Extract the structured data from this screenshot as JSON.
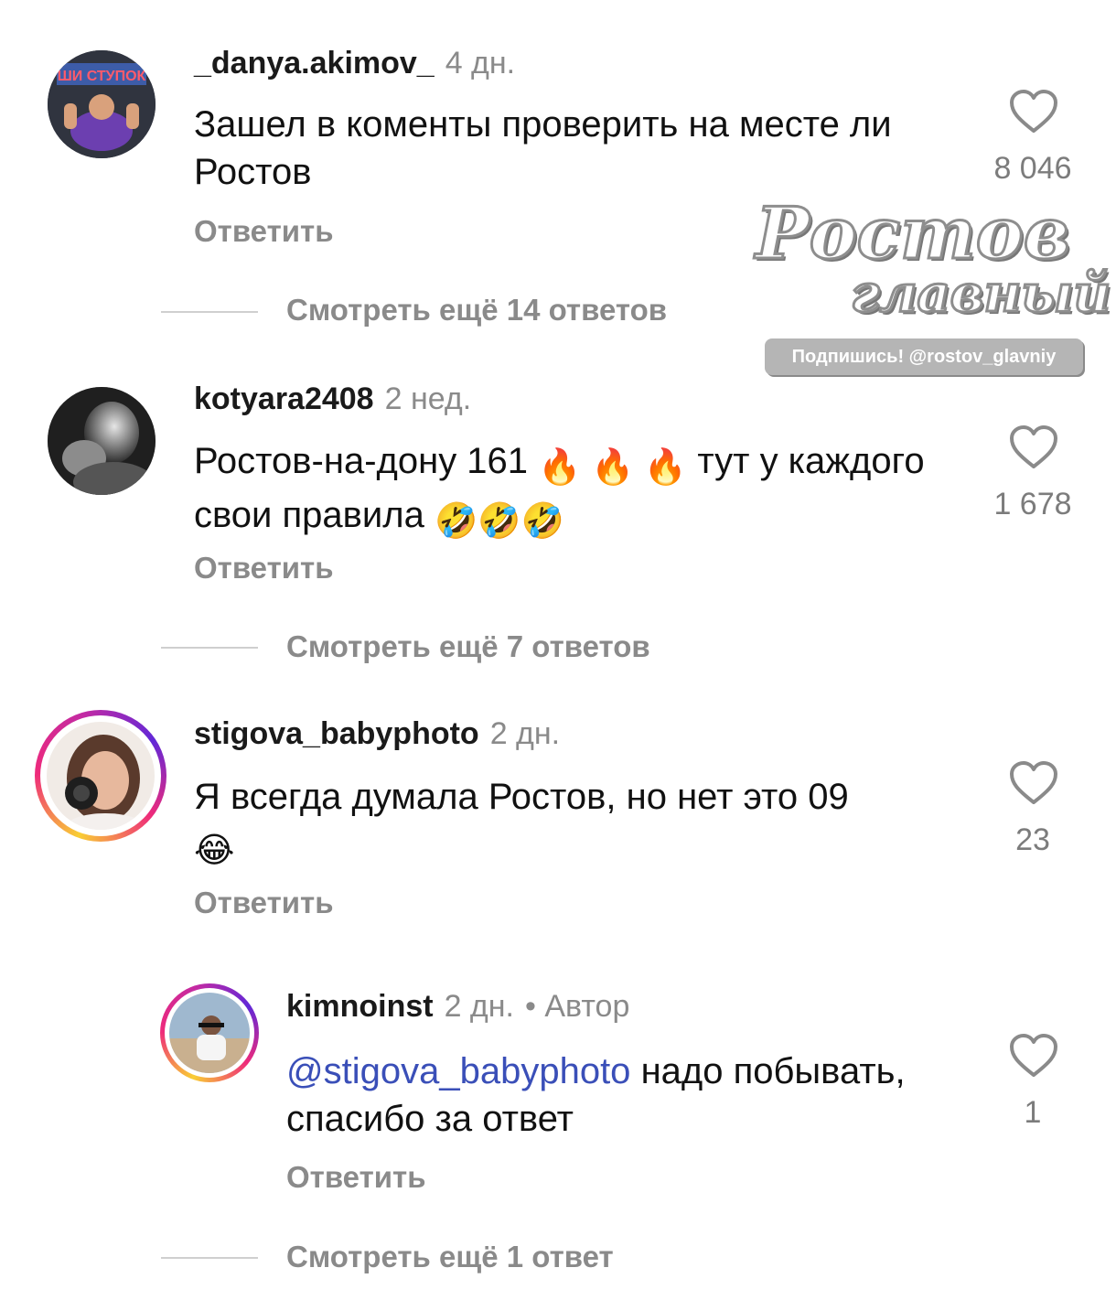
{
  "comments": [
    {
      "username": "_danya.akimov_",
      "time": "4 дн.",
      "text": "Зашел в коменты проверить на месте ли Ростов",
      "reply_label": "Ответить",
      "likes": "8 046",
      "view_more": "Смотреть ещё 14 ответов",
      "avatar_text": "ШИ СТУПОК"
    },
    {
      "username": "kotyara2408",
      "time": "2 нед.",
      "text_prefix": "Ростов-на-дону  161",
      "fire_emojis": "🔥 🔥 🔥",
      "text_middle": "тут у каждого свои правила",
      "laugh_emojis": "🤣🤣🤣",
      "reply_label": "Ответить",
      "likes": "1 678",
      "view_more": "Смотреть ещё 7 ответов"
    },
    {
      "username": "stigova_babyphoto",
      "time": "2 дн.",
      "text": "Я всегда думала Ростов, но нет это 09",
      "emoji": "😂",
      "reply_label": "Ответить",
      "likes": "23"
    }
  ],
  "reply": {
    "username": "kimnoinst",
    "time": "2 дн.",
    "author_badge": "• Автор",
    "mention": "@stigova_babyphoto",
    "text": "надо побывать, спасибо за ответ",
    "reply_label": "Ответить",
    "likes": "1",
    "view_more": "Смотреть ещё 1 ответ"
  },
  "watermark": {
    "line1": "Ростов",
    "line2": "главный",
    "subscribe": "Подпишись! @rostov_glavniy"
  },
  "colors": {
    "mention": "#3a4fb8",
    "secondary_text": "#8a8a8a",
    "story_ring": [
      "#f9ce34",
      "#ee2a7b",
      "#6228d7"
    ]
  },
  "icons": [
    "heart-outline-icon"
  ]
}
